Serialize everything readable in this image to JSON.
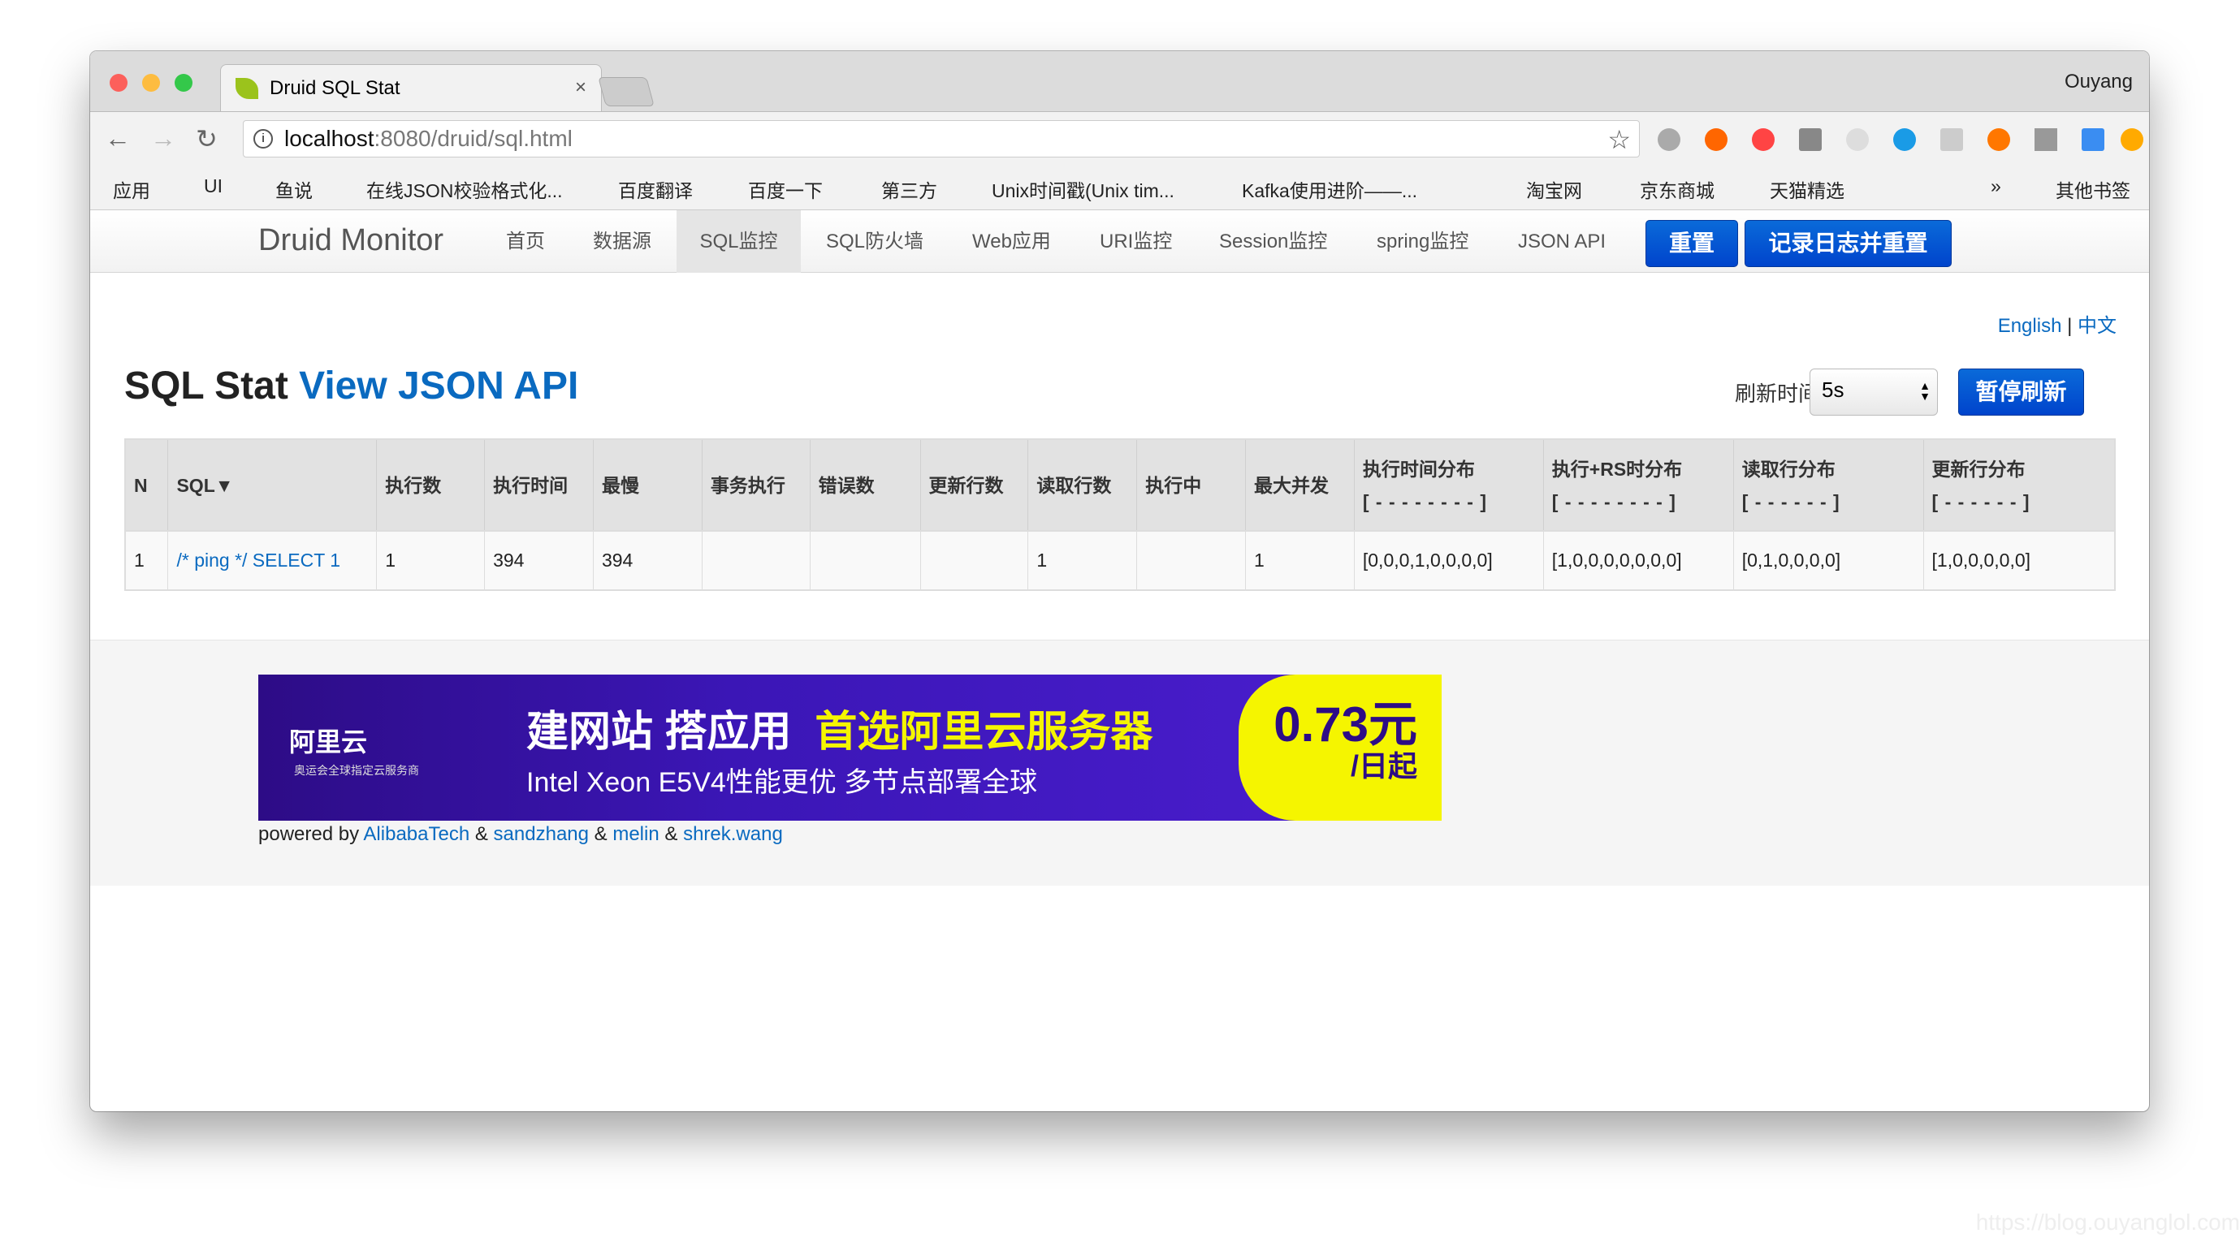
{
  "browser": {
    "tab_title": "Druid SQL Stat",
    "user": "Ouyang",
    "url_host": "localhost",
    "url_path": ":8080/druid/sql.html",
    "bookmarks": [
      "应用",
      "UI",
      "鱼说",
      "在线JSON校验格式化...",
      "百度翻译",
      "百度一下",
      "第三方",
      "Unix时间戳(Unix tim...",
      "Kafka使用进阶——...",
      "淘宝网",
      "京东商城",
      "天猫精选",
      "»",
      "其他书签"
    ]
  },
  "navbar": {
    "brand": "Druid Monitor",
    "items": [
      "首页",
      "数据源",
      "SQL监控",
      "SQL防火墙",
      "Web应用",
      "URI监控",
      "Session监控",
      "spring监控",
      "JSON API"
    ],
    "active": "SQL监控",
    "reset": "重置",
    "log_reset": "记录日志并重置"
  },
  "lang": {
    "en": "English",
    "sep": "|",
    "zh": "中文"
  },
  "page": {
    "title": "SQL Stat",
    "title_link": "View JSON API",
    "refresh_label": "刷新时间",
    "refresh_value": "5s",
    "pause": "暂停刷新"
  },
  "table": {
    "headers": [
      [
        "N",
        ""
      ],
      [
        "SQL▼",
        ""
      ],
      [
        "执行数",
        ""
      ],
      [
        "执行时间",
        ""
      ],
      [
        "最慢",
        ""
      ],
      [
        "事务执行",
        ""
      ],
      [
        "错误数",
        ""
      ],
      [
        "更新行数",
        ""
      ],
      [
        "读取行数",
        ""
      ],
      [
        "执行中",
        ""
      ],
      [
        "最大并发",
        ""
      ],
      [
        "执行时间分布",
        "[ - - - - - - - - ]"
      ],
      [
        "执行+RS时分布",
        "[ - - - - - - - - ]"
      ],
      [
        "读取行分布",
        "[ - - - - - - ]"
      ],
      [
        "更新行分布",
        "[ - - - - - - ]"
      ]
    ],
    "rows": [
      [
        "1",
        "/* ping */ SELECT 1",
        "1",
        "394",
        "394",
        "",
        "",
        "",
        "1",
        "",
        "1",
        "[0,0,0,1,0,0,0,0]",
        "[1,0,0,0,0,0,0,0]",
        "[0,1,0,0,0,0]",
        "[1,0,0,0,0,0]"
      ]
    ]
  },
  "banner": {
    "logo": "阿里云",
    "logo_sub": "奥运会全球指定云服务商",
    "headline1": "建网站 搭应用",
    "headline2": "首选阿里云服务器",
    "subline": "Intel Xeon E5V4性能更优 多节点部署全球",
    "price": "0.73元",
    "price_unit": "/日起"
  },
  "footer": {
    "powered": "powered by",
    "authors": [
      "AlibabaTech",
      "sandzhang",
      "melin",
      "shrek.wang"
    ],
    "amp": "&"
  },
  "watermark": "https://blog.ouyanglol.com",
  "colors": {
    "link": "#0a6ac0",
    "button": "#0055d4"
  }
}
